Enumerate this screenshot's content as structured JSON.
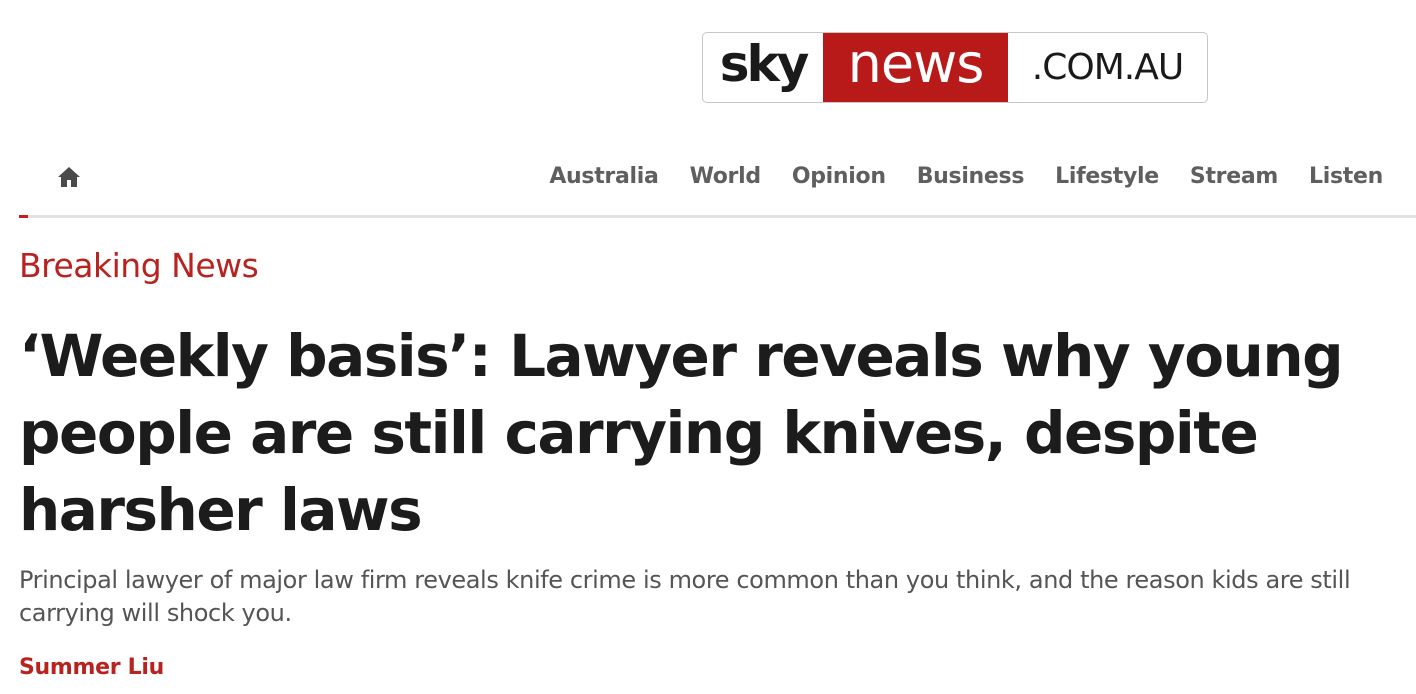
{
  "logo": {
    "sky": "sky",
    "news": "news",
    "domain": ".COM.AU"
  },
  "nav": {
    "home_icon": "home-icon",
    "items": [
      {
        "label": "Australia"
      },
      {
        "label": "World"
      },
      {
        "label": "Opinion"
      },
      {
        "label": "Business"
      },
      {
        "label": "Lifestyle"
      },
      {
        "label": "Stream"
      },
      {
        "label": "Listen"
      }
    ]
  },
  "article": {
    "category": "Breaking News",
    "headline": "‘Weekly basis’: Lawyer reveals why young people are still carrying knives, despite harsher laws",
    "standfirst": "Principal lawyer of major law firm reveals knife crime is more common than you think, and the reason kids are still carrying will shock you.",
    "author": "Summer Liu"
  },
  "colors": {
    "brand_red": "#b81a1a",
    "accent_red": "#b9231f",
    "nav_text": "#5f5f5f",
    "headline_text": "#1c1c1c",
    "body_text": "#555555"
  }
}
